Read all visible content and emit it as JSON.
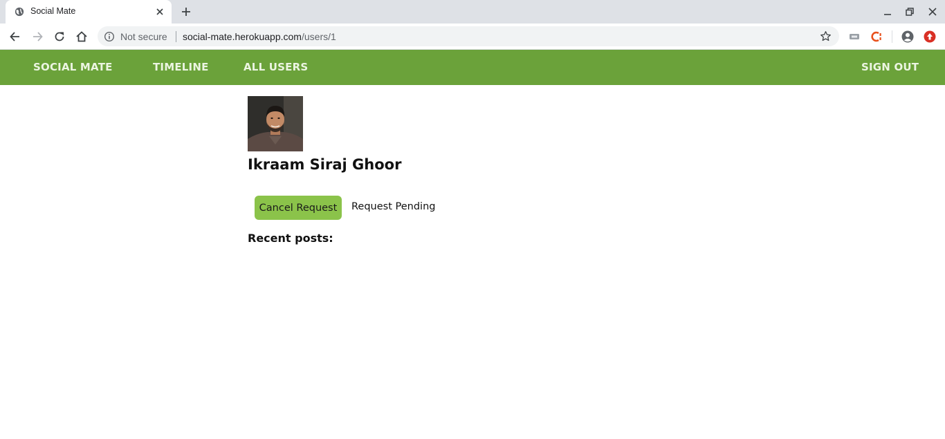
{
  "browser": {
    "tab_title": "Social Mate",
    "security_label": "Not secure",
    "url_host": "social-mate.herokuapp.com",
    "url_path": "/users/1"
  },
  "nav": {
    "brand": "SOCIAL MATE",
    "timeline": "TIMELINE",
    "all_users": "ALL USERS",
    "sign_out": "SIGN OUT"
  },
  "profile": {
    "name": "Ikraam Siraj Ghoor",
    "cancel_label": "Cancel Request",
    "status_text": "Request Pending",
    "recent_heading": "Recent posts:"
  },
  "colors": {
    "nav_bg": "#6ba23a",
    "button_bg": "#8bc34a",
    "tabbar_bg": "#dee1e6"
  }
}
